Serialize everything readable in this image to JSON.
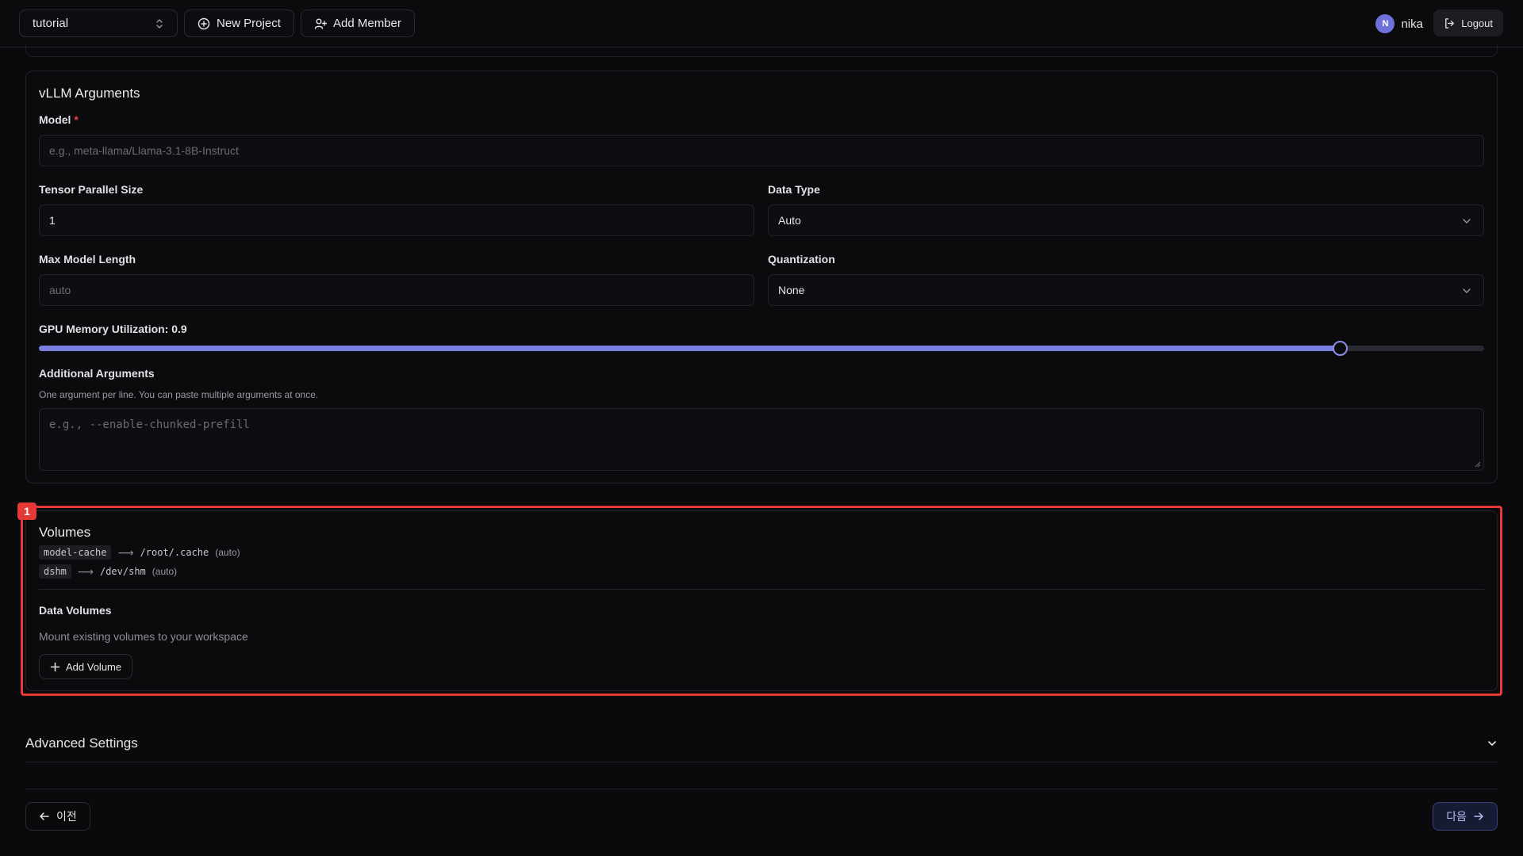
{
  "header": {
    "project_select": "tutorial",
    "new_project_label": "New Project",
    "add_member_label": "Add Member",
    "user": {
      "initial": "N",
      "name": "nika"
    },
    "logout_label": "Logout"
  },
  "vllm": {
    "title": "vLLM Arguments",
    "model": {
      "label": "Model",
      "required_mark": "*",
      "placeholder": "e.g., meta-llama/Llama-3.1-8B-Instruct"
    },
    "tensor_parallel": {
      "label": "Tensor Parallel Size",
      "value": "1"
    },
    "data_type": {
      "label": "Data Type",
      "value": "Auto"
    },
    "max_model_length": {
      "label": "Max Model Length",
      "placeholder": "auto"
    },
    "quantization": {
      "label": "Quantization",
      "value": "None"
    },
    "gpu_memory": {
      "label": "GPU Memory Utilization: 0.9",
      "value": 0.9
    },
    "additional_args": {
      "label": "Additional Arguments",
      "hint": "One argument per line. You can paste multiple arguments at once.",
      "placeholder": "e.g., --enable-chunked-prefill"
    }
  },
  "annotation": {
    "badge": "1",
    "color": "#e53935"
  },
  "volumes": {
    "title": "Volumes",
    "items": [
      {
        "name": "model-cache",
        "arrow": "⟶",
        "path": "/root/.cache",
        "note": "(auto)"
      },
      {
        "name": "dshm",
        "arrow": "⟶",
        "path": "/dev/shm",
        "note": "(auto)"
      }
    ],
    "data_volumes": {
      "title": "Data Volumes",
      "subtitle": "Mount existing volumes to your workspace",
      "add_label": "Add Volume"
    }
  },
  "advanced": {
    "title": "Advanced Settings"
  },
  "footer": {
    "prev_label": "이전",
    "next_label": "다음"
  },
  "colors": {
    "accent": "#7b7fe0",
    "background": "#0a0a0d",
    "border": "#24242b"
  }
}
